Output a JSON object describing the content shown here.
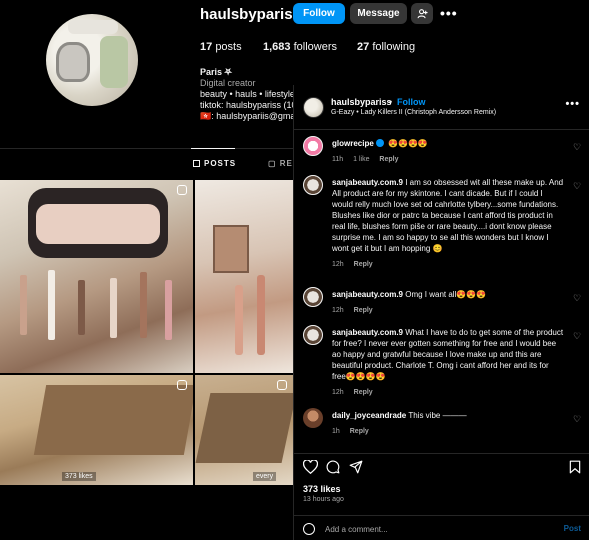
{
  "profile": {
    "username": "haulsbypariss",
    "follow_label": "Follow",
    "message_label": "Message",
    "add_user_icon": "add-user-icon",
    "more_glyph": "•••",
    "posts_count": "17",
    "posts_label": "posts",
    "followers_count": "1,683",
    "followers_label": "followers",
    "following_count": "27",
    "following_label": "following",
    "name": "Paris ⛧",
    "category": "Digital creator",
    "bio_line1": "beauty • hauls • lifestyle",
    "bio_line2": "tiktok: haulsbypariss (10",
    "bio_line3": "🇭🇰: haulsbypariis@gma"
  },
  "tabs": {
    "posts": "POSTS",
    "reels": "RE"
  },
  "grid": {
    "tile3_caption": "373 likes",
    "tile4_caption": "every"
  },
  "post": {
    "author": "haulsbypariss",
    "dot": "•",
    "follow": "Follow",
    "song": "G-Eazy • Lady Killers II (Christoph Andersson Remix)",
    "more_glyph": "•••",
    "comments": [
      {
        "user": "glowrecipe",
        "verified": true,
        "text": "😍😍😍😍",
        "time": "11h",
        "likes": "1 like",
        "reply": "Reply"
      },
      {
        "user": "sanjabeauty.com.9",
        "text": "I am so obsessed wit all these make up. And All product are for my skintone. I cant dicade. But if I could I would relly much love set od cahrlotte tylbery...some fundations. Blushes like dior or patrc ta because I cant afford tis product in real life, blushes form piše or rare beauty....i dont know please surprise me. I am so happy to se all this wonders but I know I wont get it but I am hopping 😊",
        "time": "12h",
        "reply": "Reply"
      },
      {
        "user": "sanjabeauty.com.9",
        "text": "Omg I want all😍😍😍",
        "time": "12h",
        "reply": "Reply"
      },
      {
        "user": "sanjabeauty.com.9",
        "text": "What I have to do to get some of the product for free? I never ever gotten something for free and I would bee ao happy and gratwful because I love make up and this are beautiful product. Charlote T. Omg i cant afford her and its for free😍😍😍😍",
        "time": "12h",
        "reply": "Reply"
      },
      {
        "user": "daily_joyceandrade",
        "text": "This vibe ———",
        "time": "1h",
        "reply": "Reply"
      }
    ],
    "likes": "373 likes",
    "ago": "13 hours ago",
    "add_comment_placeholder": "Add a comment...",
    "post_label": "Post"
  }
}
